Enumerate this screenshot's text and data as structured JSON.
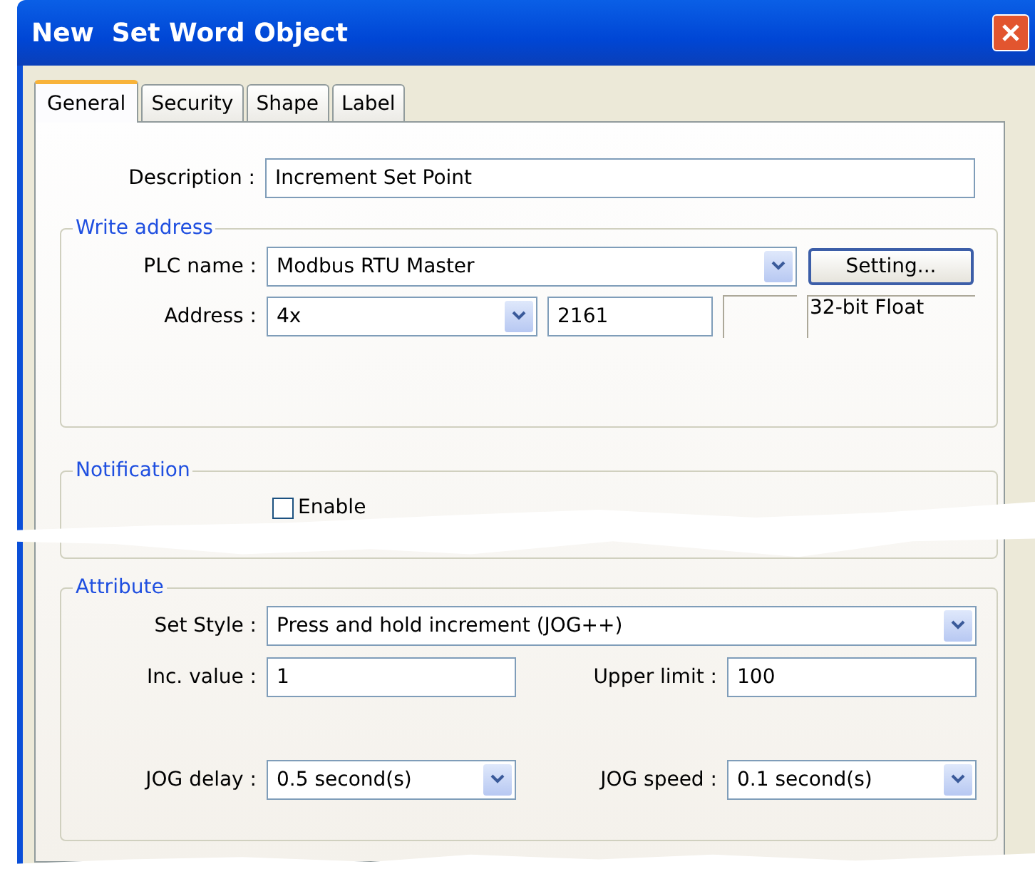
{
  "window": {
    "title": "New  Set Word Object"
  },
  "tabs": [
    {
      "label": "General",
      "selected": true
    },
    {
      "label": "Security",
      "selected": false
    },
    {
      "label": "Shape",
      "selected": false
    },
    {
      "label": "Label",
      "selected": false
    }
  ],
  "description": {
    "label": "Description :",
    "value": "Increment Set Point"
  },
  "write_address": {
    "title": "Write address",
    "plc_name": {
      "label": "PLC name :",
      "value": "Modbus RTU Master"
    },
    "setting_button": "Setting...",
    "address": {
      "label": "Address :",
      "type": "4x",
      "value": "2161",
      "data_type": "32-bit Float"
    }
  },
  "notification": {
    "title": "Notification",
    "enable": {
      "label": "Enable",
      "checked": false
    }
  },
  "attribute": {
    "title": "Attribute",
    "set_style": {
      "label": "Set Style :",
      "value": "Press and hold increment (JOG++)"
    },
    "inc_value": {
      "label": "Inc. value :",
      "value": "1"
    },
    "upper_limit": {
      "label": "Upper limit :",
      "value": "100"
    },
    "jog_delay": {
      "label": "JOG delay :",
      "value": "0.5  second(s)"
    },
    "jog_speed": {
      "label": "JOG speed :",
      "value": "0.1  second(s)"
    }
  }
}
